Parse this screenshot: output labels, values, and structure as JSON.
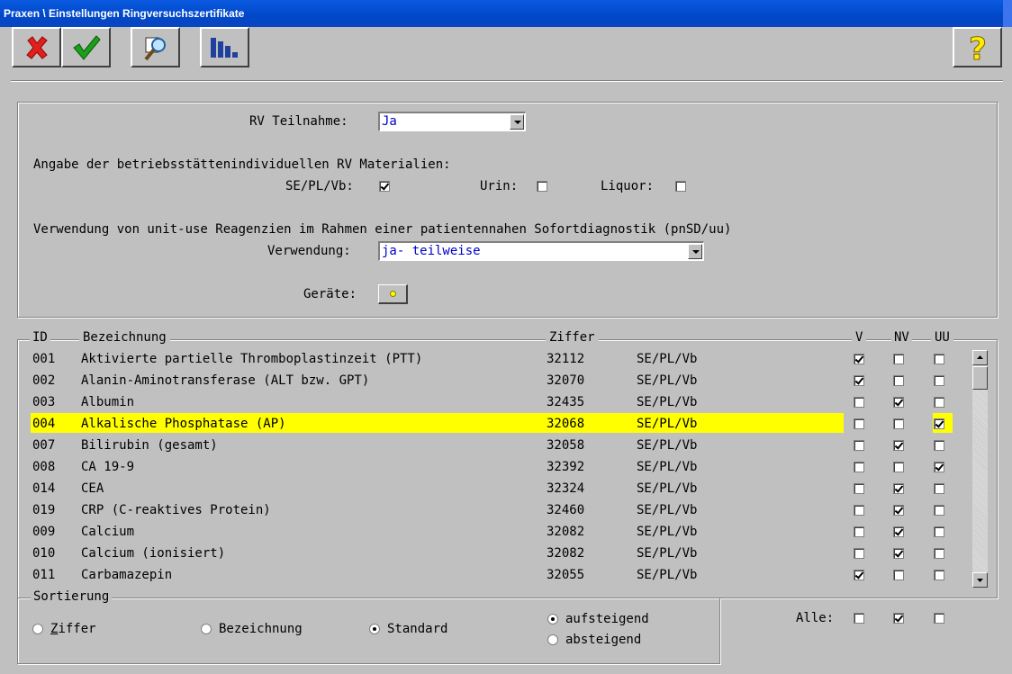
{
  "window": {
    "title": "Praxen \\ Einstellungen Ringversuchszertifikate"
  },
  "toolbar": {
    "icons": [
      "close-icon",
      "checkmark-icon",
      "search-magnifier-icon",
      "bar-chart-icon",
      "help-icon"
    ]
  },
  "settings": {
    "rv_label": "RV Teilnahme:",
    "rv_value": "Ja",
    "materials_heading": "Angabe der betriebsstättenindividuellen RV Materialien:",
    "se_label": "SE/PL/Vb:",
    "se_checked": true,
    "urin_label": "Urin:",
    "urin_checked": false,
    "liquor_label": "Liquor:",
    "liquor_checked": false,
    "unituse_heading": "Verwendung von unit-use Reagenzien im Rahmen einer patientennahen Sofortdiagnostik (pnSD/uu)",
    "verwendung_label": "Verwendung:",
    "verwendung_value": "ja- teilweise",
    "geraete_label": "Geräte:"
  },
  "table": {
    "headers": {
      "id": "ID",
      "bez": "Bezeichnung",
      "ziffer": "Ziffer",
      "v": "V",
      "nv": "NV",
      "uu": "UU"
    },
    "rows": [
      {
        "id": "001",
        "bez": "Aktivierte partielle Thromboplastinzeit (PTT)",
        "ziffer": "32112",
        "mat": "SE/PL/Vb",
        "v": true,
        "nv": false,
        "uu": false
      },
      {
        "id": "002",
        "bez": "Alanin-Aminotransferase (ALT bzw. GPT)",
        "ziffer": "32070",
        "mat": "SE/PL/Vb",
        "v": true,
        "nv": false,
        "uu": false
      },
      {
        "id": "003",
        "bez": "Albumin",
        "ziffer": "32435",
        "mat": "SE/PL/Vb",
        "v": false,
        "nv": true,
        "uu": false
      },
      {
        "id": "004",
        "bez": "Alkalische Phosphatase (AP)",
        "ziffer": "32068",
        "mat": "SE/PL/Vb",
        "v": false,
        "nv": false,
        "uu": true,
        "selected": true
      },
      {
        "id": "007",
        "bez": "Bilirubin (gesamt)",
        "ziffer": "32058",
        "mat": "SE/PL/Vb",
        "v": false,
        "nv": true,
        "uu": false
      },
      {
        "id": "008",
        "bez": "CA 19-9",
        "ziffer": "32392",
        "mat": "SE/PL/Vb",
        "v": false,
        "nv": false,
        "uu": true
      },
      {
        "id": "014",
        "bez": "CEA",
        "ziffer": "32324",
        "mat": "SE/PL/Vb",
        "v": false,
        "nv": true,
        "uu": false
      },
      {
        "id": "019",
        "bez": "CRP (C-reaktives Protein)",
        "ziffer": "32460",
        "mat": "SE/PL/Vb",
        "v": false,
        "nv": true,
        "uu": false
      },
      {
        "id": "009",
        "bez": "Calcium",
        "ziffer": "32082",
        "mat": "SE/PL/Vb",
        "v": false,
        "nv": true,
        "uu": false
      },
      {
        "id": "010",
        "bez": "Calcium (ionisiert)",
        "ziffer": "32082",
        "mat": "SE/PL/Vb",
        "v": false,
        "nv": true,
        "uu": false
      },
      {
        "id": "011",
        "bez": "Carbamazepin",
        "ziffer": "32055",
        "mat": "SE/PL/Vb",
        "v": true,
        "nv": false,
        "uu": false
      }
    ]
  },
  "sort": {
    "title": "Sortierung",
    "ziffer": "Ziffer",
    "bezeichnung": "Bezeichnung",
    "standard": "Standard",
    "selected": "standard",
    "asc": "aufsteigend",
    "desc": "absteigend",
    "order": "asc"
  },
  "alle": {
    "label": "Alle:",
    "v": false,
    "nv": true,
    "uu": false
  }
}
